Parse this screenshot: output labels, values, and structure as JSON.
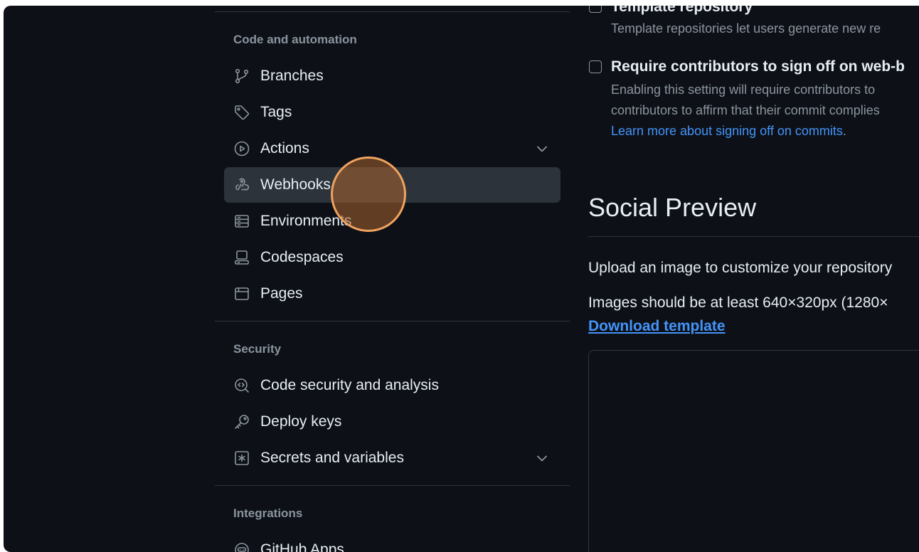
{
  "sidebar": {
    "sections": [
      {
        "heading": "Code and automation",
        "items": [
          {
            "label": "Branches",
            "icon": "git-branch-icon"
          },
          {
            "label": "Tags",
            "icon": "tag-icon"
          },
          {
            "label": "Actions",
            "icon": "play-icon",
            "expandable": true
          },
          {
            "label": "Webhooks",
            "icon": "webhook-icon",
            "active": true
          },
          {
            "label": "Environments",
            "icon": "server-icon"
          },
          {
            "label": "Codespaces",
            "icon": "codespaces-icon"
          },
          {
            "label": "Pages",
            "icon": "browser-icon"
          }
        ]
      },
      {
        "heading": "Security",
        "items": [
          {
            "label": "Code security and analysis",
            "icon": "codescan-icon"
          },
          {
            "label": "Deploy keys",
            "icon": "key-icon"
          },
          {
            "label": "Secrets and variables",
            "icon": "asterisk-icon",
            "expandable": true
          }
        ]
      },
      {
        "heading": "Integrations",
        "items": [
          {
            "label": "GitHub Apps",
            "icon": "hubot-icon"
          }
        ]
      }
    ]
  },
  "main": {
    "template_repo": {
      "title": "Template repository",
      "description": "Template repositories let users generate new re",
      "checked": false
    },
    "signoff": {
      "title": "Require contributors to sign off on web-b",
      "description_1": "Enabling this setting will require contributors to",
      "description_2": "contributors to affirm that their commit complies",
      "link": "Learn more about signing off on commits",
      "link_suffix": ".",
      "checked": false
    },
    "social_preview": {
      "title": "Social Preview",
      "upload_text": "Upload an image to customize your repository",
      "size_text": "Images should be at least 640×320px (1280×",
      "download_link": "Download template"
    }
  },
  "colors": {
    "background": "#0d1117",
    "text": "#e6edf3",
    "muted": "#8b949e",
    "link": "#4493f8",
    "border": "#30363d",
    "active_item": "#2d333b",
    "cursor_ring": "#f0a35e"
  }
}
